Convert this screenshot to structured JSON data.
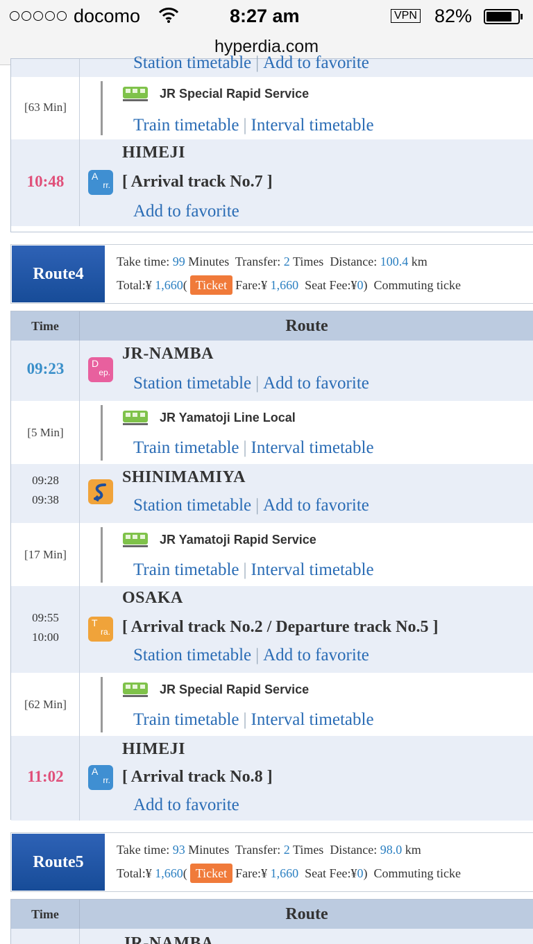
{
  "status_bar": {
    "carrier": "docomo",
    "time": "8:27 am",
    "vpn": "VPN",
    "battery": "82%",
    "battery_level": 0.82
  },
  "url": "hyperdia.com",
  "links": {
    "station_timetable": "Station timetable",
    "add_favorite": "Add to favorite",
    "train_timetable": "Train timetable",
    "interval_timetable": "Interval timetable",
    "separator": "|"
  },
  "route3_tail": {
    "segment": {
      "duration": "[63 Min]",
      "train": "JR Special Rapid Service"
    },
    "arrival": {
      "station": "HIMEJI",
      "time": "10:48",
      "track": "[ Arrival track No.7 ]"
    }
  },
  "route4": {
    "label": "Route4",
    "take_time_label": "Take time:",
    "take_time": "99",
    "take_time_unit": "Minutes",
    "transfer_label": "Transfer:",
    "transfer": "2",
    "transfer_unit": "Times",
    "distance_label": "Distance:",
    "distance": "100.4",
    "distance_unit": "km",
    "total_label": "Total:¥",
    "total": "1,660",
    "ticket": "Ticket",
    "fare_label": "Fare:¥",
    "fare": "1,660",
    "seat_label": "Seat Fee:¥",
    "seat": "0",
    "commuting": "Commuting ticke",
    "header": {
      "time": "Time",
      "route": "Route"
    },
    "stops": [
      {
        "station": "JR-NAMBA",
        "time": "09:23"
      },
      {
        "duration": "[5 Min]",
        "train": "JR Yamatoji Line Local"
      },
      {
        "station": "SHINIMAMIYA",
        "arr": "09:28",
        "dep": "09:38"
      },
      {
        "duration": "[17 Min]",
        "train": "JR Yamatoji Rapid Service"
      },
      {
        "station": "OSAKA",
        "arr": "09:55",
        "dep": "10:00",
        "track": "[ Arrival track No.2 / Departure track No.5 ]"
      },
      {
        "duration": "[62 Min]",
        "train": "JR Special Rapid Service"
      },
      {
        "station": "HIMEJI",
        "time": "11:02",
        "track": "[ Arrival track No.8 ]"
      }
    ]
  },
  "route5": {
    "label": "Route5",
    "take_time": "93",
    "transfer": "2",
    "distance": "98.0",
    "total": "1,660",
    "fare": "1,660",
    "seat": "0",
    "header": {
      "time": "Time",
      "route": "Route"
    },
    "first_station": "JR-NAMBA"
  },
  "badges": {
    "dep": [
      "D",
      "ep."
    ],
    "arr": [
      "A",
      "rr."
    ],
    "tra": [
      "T",
      "ra."
    ]
  },
  "colors": {
    "link": "#2a6cb5",
    "dep_time": "#3a8fc9",
    "arr_time": "#e0507a",
    "route_label": "#1f55a3",
    "ticket": "#f07a3a",
    "station_bg": "#e9eef7"
  }
}
